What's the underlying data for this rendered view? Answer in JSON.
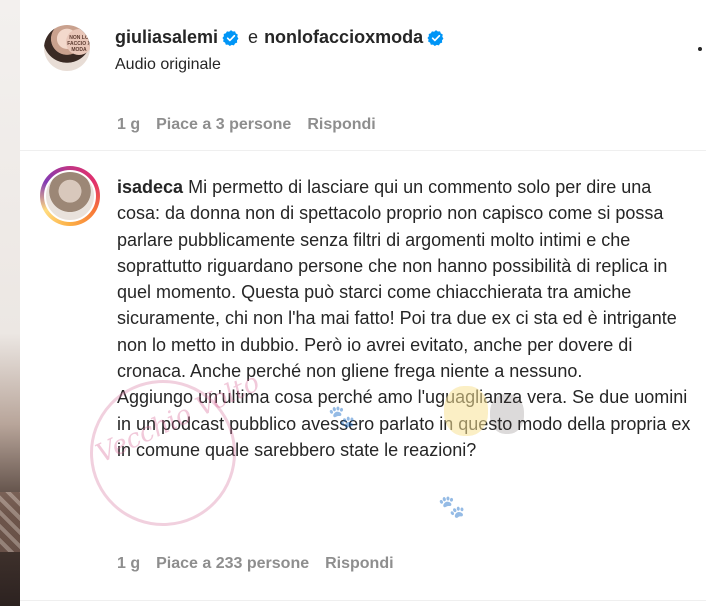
{
  "post_header": {
    "author1": "giuliasalemi",
    "conjunction": "e",
    "author2": "nonlofaccioxmoda",
    "subtitle": "Audio originale",
    "avatar_badge_text": "NON LO FACCIO X MODA"
  },
  "first_comment_meta": {
    "time": "1 g",
    "likes": "Piace a 3 persone",
    "reply": "Rispondi"
  },
  "comment": {
    "username": "isadeca",
    "paragraph1": "Mi permetto di lasciare qui un commento solo per dire una cosa: da donna non di spettacolo proprio non capisco come si possa parlare pubblicamente senza filtri di argomenti molto intimi e che soprattutto riguardano persone che non hanno possibilità di replica in quel momento. Questa può starci come chiacchierata tra amiche sicuramente, chi non l'ha mai fatto! Poi tra due ex ci sta ed è intrigante non lo metto in dubbio. Però io avrei evitato, anche per dovere di cronaca. Anche perché non gliene frega niente a nessuno.",
    "paragraph2": "Aggiungo un'ultima cosa perché amo l'uguaglianza vera. Se due uomini in un podcast pubblico avessero parlato in questo modo della propria ex in comune quale sarebbero state le reazioni?",
    "time": "1 g",
    "likes": "Piace a 233 persone",
    "reply": "Rispondi"
  },
  "watermark_text": "Vecchio Volto",
  "icons": {
    "verified": "verified-badge-icon",
    "more": "more-options-icon"
  },
  "colors": {
    "text": "#262626",
    "secondary": "#8e8e8e",
    "verified": "#0095f6"
  }
}
